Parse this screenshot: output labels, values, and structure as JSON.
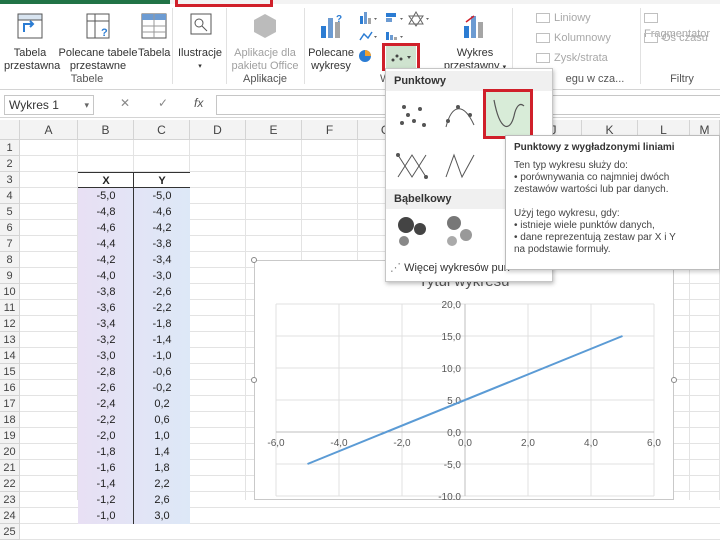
{
  "ribbon": {
    "tables_group": {
      "label": "Tabele",
      "pivot": [
        "Tabela",
        "przestawna"
      ],
      "recommended_pivot": [
        "Polecane tabele",
        "przestawne"
      ],
      "table": "Tabela"
    },
    "illustrations": "Ilustracje",
    "apps_group": {
      "label": "Aplikacje",
      "office_apps": [
        "Aplikacje dla",
        "pakietu Office"
      ]
    },
    "recommended_charts": [
      "Polecane",
      "wykresy"
    ],
    "pivot_chart": [
      "Wykres",
      "przestawny"
    ],
    "sparklines": {
      "line": "Liniowy",
      "column": "Kolumnowy",
      "win_loss": "Zysk/strata",
      "label_partial": "egu w cza..."
    },
    "filters_group": {
      "label": "Filtry",
      "slicer": "Fragmentator",
      "timeline": "Oś czasu"
    },
    "charts_label_partial": "W"
  },
  "formula_bar": {
    "name_box": "Wykres 1",
    "cancel": "✕",
    "enter": "✓",
    "fx": "fx"
  },
  "sheet": {
    "columns": [
      "A",
      "B",
      "C",
      "D",
      "E",
      "F",
      "G",
      "H",
      "I",
      "J",
      "K",
      "L",
      "M"
    ],
    "rows": [
      "1",
      "2",
      "3",
      "4",
      "5",
      "6",
      "7",
      "8",
      "9",
      "10",
      "11",
      "12",
      "13",
      "14",
      "15",
      "16",
      "17",
      "18",
      "19",
      "20",
      "21",
      "22",
      "23",
      "24",
      "25"
    ],
    "table_header": [
      "X",
      "Y"
    ],
    "table_rows": [
      [
        "-5,0",
        "-5,0"
      ],
      [
        "-4,8",
        "-4,6"
      ],
      [
        "-4,6",
        "-4,2"
      ],
      [
        "-4,4",
        "-3,8"
      ],
      [
        "-4,2",
        "-3,4"
      ],
      [
        "-4,0",
        "-3,0"
      ],
      [
        "-3,8",
        "-2,6"
      ],
      [
        "-3,6",
        "-2,2"
      ],
      [
        "-3,4",
        "-1,8"
      ],
      [
        "-3,2",
        "-1,4"
      ],
      [
        "-3,0",
        "-1,0"
      ],
      [
        "-2,8",
        "-0,6"
      ],
      [
        "-2,6",
        "-0,2"
      ],
      [
        "-2,4",
        "0,2"
      ],
      [
        "-2,2",
        "0,6"
      ],
      [
        "-2,0",
        "1,0"
      ],
      [
        "-1,8",
        "1,4"
      ],
      [
        "-1,6",
        "1,8"
      ],
      [
        "-1,4",
        "2,2"
      ],
      [
        "-1,2",
        "2,6"
      ],
      [
        "-1,0",
        "3,0"
      ]
    ]
  },
  "chart": {
    "title": "Tytuł wykresu",
    "x_ticks": [
      "-6,0",
      "-4,0",
      "-2,0",
      "0,0",
      "2,0",
      "4,0",
      "6,0"
    ],
    "y_ticks": [
      "20,0",
      "15,0",
      "10,0",
      "5,0",
      "0,0",
      "-5,0",
      "-10,0"
    ],
    "line_color": "#5b9bd5"
  },
  "chart_data": {
    "type": "line",
    "title": "Tytuł wykresu",
    "x": [
      -5.0,
      5.0
    ],
    "series": [
      {
        "values": [
          -5.0,
          15.0
        ]
      }
    ],
    "xlim": [
      -6,
      6
    ],
    "ylim": [
      -10,
      20
    ],
    "grid": true
  },
  "dropdown": {
    "scatter_heading": "Punktowy",
    "bubble_heading": "Bąbelkowy",
    "more_charts": "Więcej wykresów pun"
  },
  "tooltip": {
    "title": "Punktowy z wygładzonymi liniami",
    "lines": [
      "Ten typ wykresu służy do:",
      "• porównywania co najmniej dwóch",
      "zestawów wartości lub par danych.",
      "",
      "Użyj tego wykresu, gdy:",
      "• istnieje wiele punktów danych,",
      "• dane reprezentują zestaw par X i Y",
      "na podstawie formuły."
    ]
  },
  "colors": {
    "accent_red": "#d0202a",
    "excel_green": "#217346"
  }
}
